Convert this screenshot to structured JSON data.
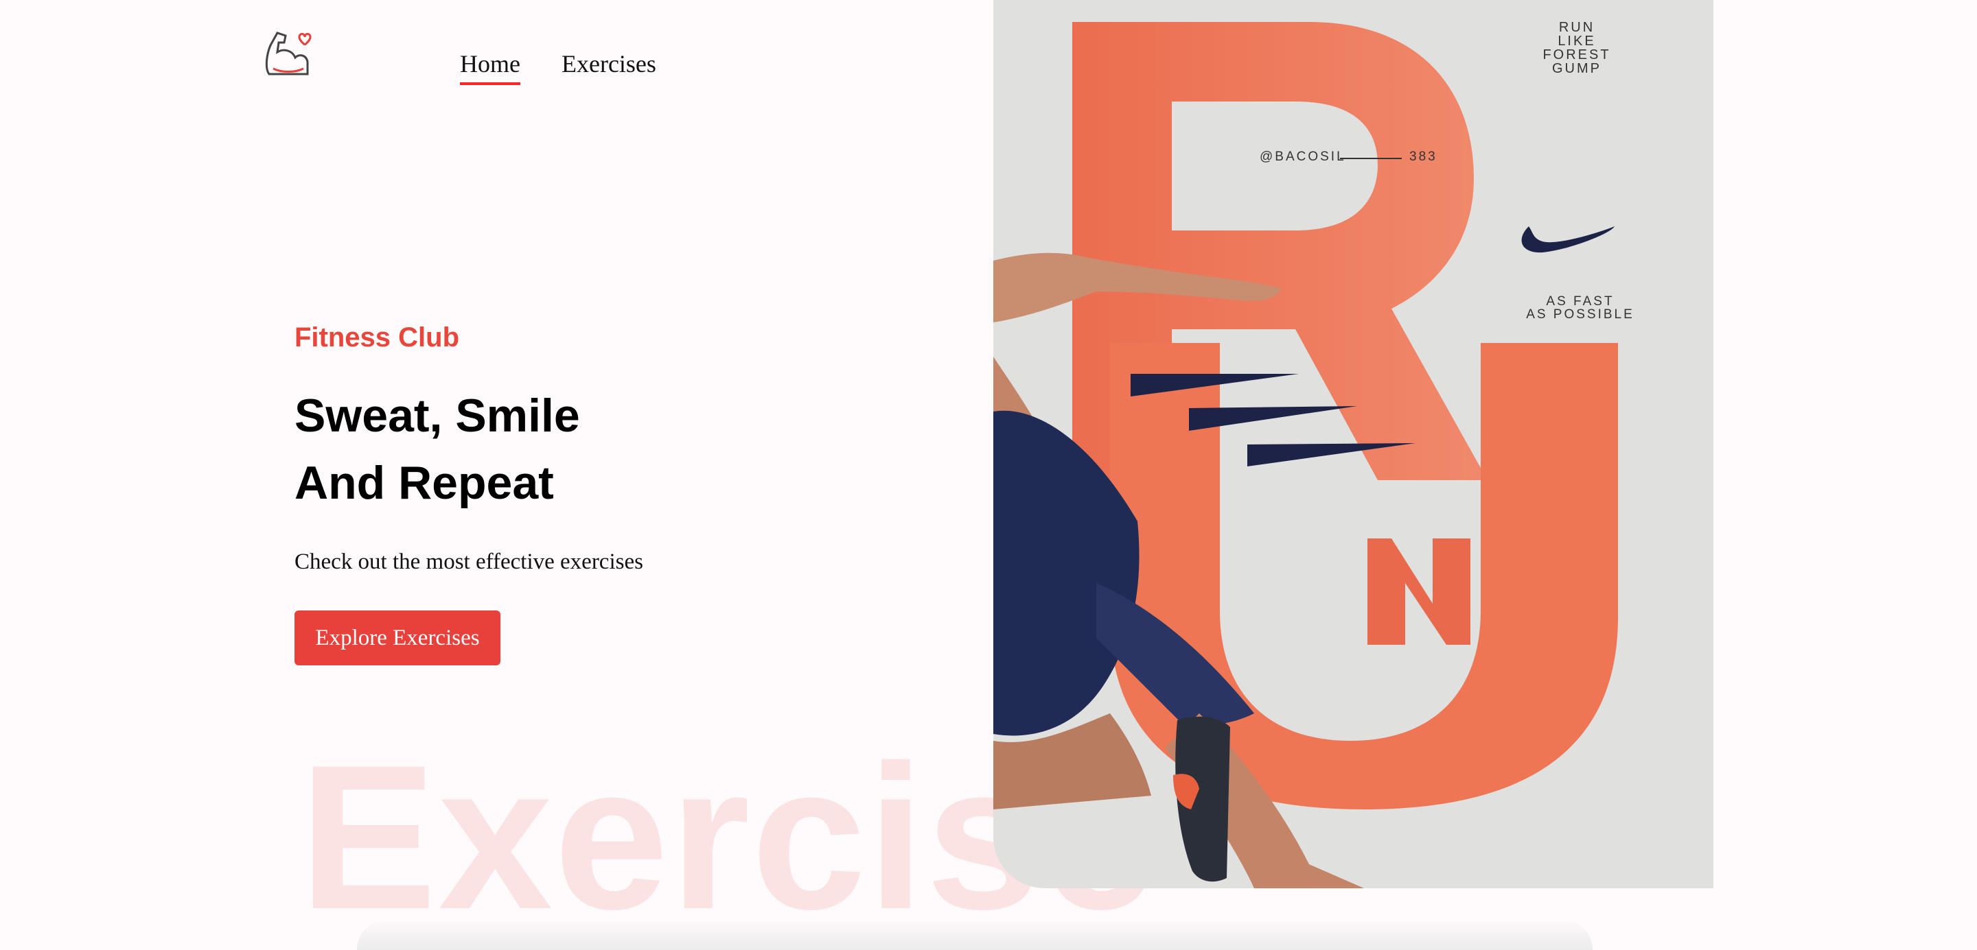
{
  "nav": {
    "home": "Home",
    "exercises": "Exercises"
  },
  "hero": {
    "eyebrow": "Fitness Club",
    "headline_line1": "Sweat, Smile",
    "headline_line2": "And Repeat",
    "subtitle": "Check out the most effective exercises",
    "cta": "Explore Exercises"
  },
  "watermark": "Exercise",
  "poster": {
    "run_line1": "RUN",
    "run_line2": "LIKE",
    "run_line3": "FOREST",
    "run_line4": "GUMP",
    "handle": "@BACOSIL",
    "number": "383",
    "tag_line1": "AS FAST",
    "tag_line2": "AS POSSIBLE"
  },
  "colors": {
    "accent": "#e8403a",
    "poster_orange": "#ee7655",
    "navy": "#1c2346"
  }
}
